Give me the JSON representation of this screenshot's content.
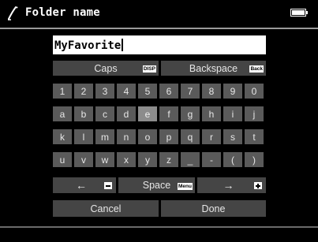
{
  "header": {
    "title": "Folder name",
    "icon": "pen-icon",
    "battery": "battery-icon"
  },
  "input": {
    "value": "MyFavorite"
  },
  "keyboard": {
    "caps": {
      "label": "Caps",
      "badge": "DISP"
    },
    "backspace": {
      "label": "Backspace",
      "badge": "Back"
    },
    "rows": [
      [
        "1",
        "2",
        "3",
        "4",
        "5",
        "6",
        "7",
        "8",
        "9",
        "0"
      ],
      [
        "a",
        "b",
        "c",
        "d",
        "e",
        "f",
        "g",
        "h",
        "i",
        "j"
      ],
      [
        "k",
        "l",
        "m",
        "n",
        "o",
        "p",
        "q",
        "r",
        "s",
        "t"
      ],
      [
        "u",
        "v",
        "w",
        "x",
        "y",
        "z",
        "_",
        "-",
        "(",
        ")"
      ]
    ],
    "highlighted": "e",
    "left_arrow": "←",
    "space": {
      "label": "Space",
      "badge": "Menu"
    },
    "right_arrow": "→",
    "cancel": "Cancel",
    "done": "Done"
  }
}
